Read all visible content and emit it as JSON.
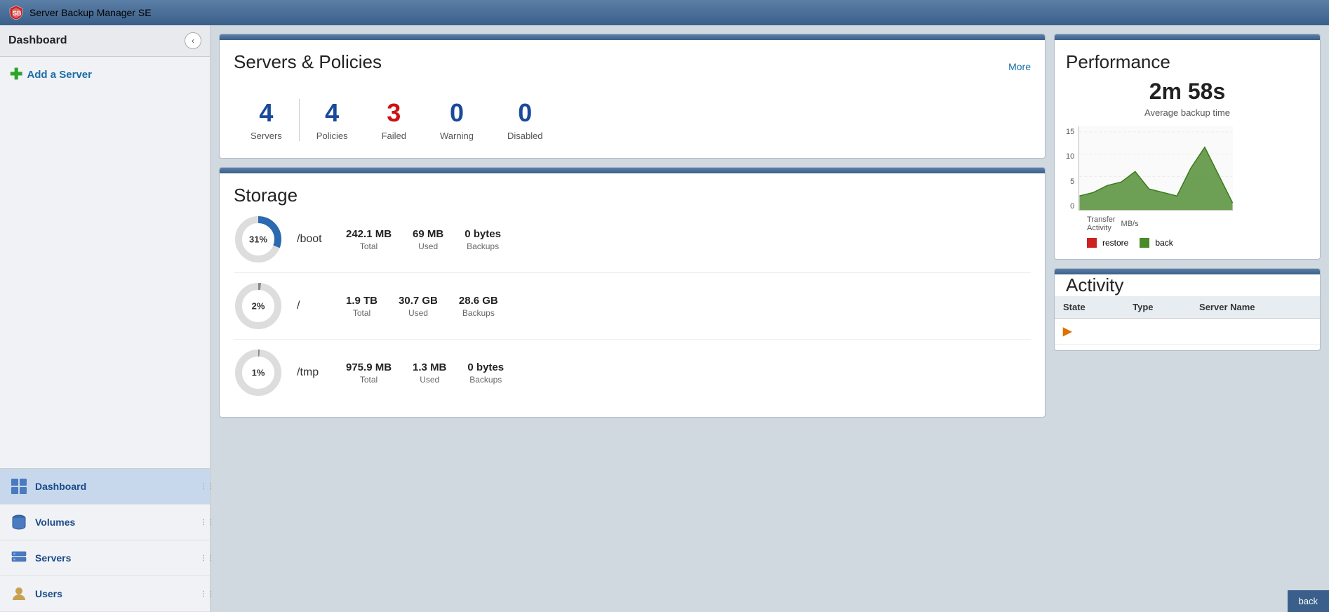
{
  "app": {
    "title": "Server Backup Manager SE"
  },
  "sidebar": {
    "header": "Dashboard",
    "collapse_btn": "‹",
    "add_server_label": "Add a Server",
    "nav_items": [
      {
        "id": "dashboard",
        "label": "Dashboard",
        "icon": "dashboard",
        "active": true
      },
      {
        "id": "volumes",
        "label": "Volumes",
        "icon": "volumes",
        "active": false
      },
      {
        "id": "servers",
        "label": "Servers",
        "icon": "servers",
        "active": false
      },
      {
        "id": "users",
        "label": "Users",
        "icon": "users",
        "active": false
      }
    ]
  },
  "servers_policies": {
    "title": "Servers & Policies",
    "more_label": "More",
    "servers_count": "4",
    "policies_count": "4",
    "failed_count": "3",
    "warning_count": "0",
    "disabled_count": "0",
    "servers_label": "Servers",
    "policies_label": "Policies",
    "failed_label": "Failed",
    "warning_label": "Warning",
    "disabled_label": "Disabled"
  },
  "storage": {
    "title": "Storage",
    "rows": [
      {
        "percent": "31%",
        "percent_num": 31,
        "mount": "/boot",
        "total": "242.1 MB",
        "used": "69 MB",
        "backups": "0 bytes",
        "color": "#2a6ab0"
      },
      {
        "percent": "2%",
        "percent_num": 2,
        "mount": "/",
        "total": "1.9 TB",
        "used": "30.7 GB",
        "backups": "28.6 GB",
        "color": "#888"
      },
      {
        "percent": "1%",
        "percent_num": 1,
        "mount": "/tmp",
        "total": "975.9 MB",
        "used": "1.3 MB",
        "backups": "0 bytes",
        "color": "#888"
      }
    ],
    "total_label": "Total",
    "used_label": "Used",
    "backups_label": "Backups"
  },
  "performance": {
    "title": "Performance",
    "avg_time": "2m 58s",
    "avg_time_label": "Average backup time",
    "transfer_label": "Transfer Activity",
    "y_axis_labels": [
      "15",
      "10",
      "5",
      "0"
    ],
    "mb_s_label": "MB/s",
    "legend": [
      {
        "key": "restore",
        "label": "restore",
        "color": "#cc2222"
      },
      {
        "key": "backup",
        "label": "back",
        "color": "#4a8a2a"
      }
    ]
  },
  "activity": {
    "title": "Activity",
    "columns": [
      "State",
      "Type",
      "Server Name"
    ],
    "rows": [
      {
        "state": "▶",
        "type": "",
        "server": ""
      }
    ]
  },
  "back_btn": "back"
}
